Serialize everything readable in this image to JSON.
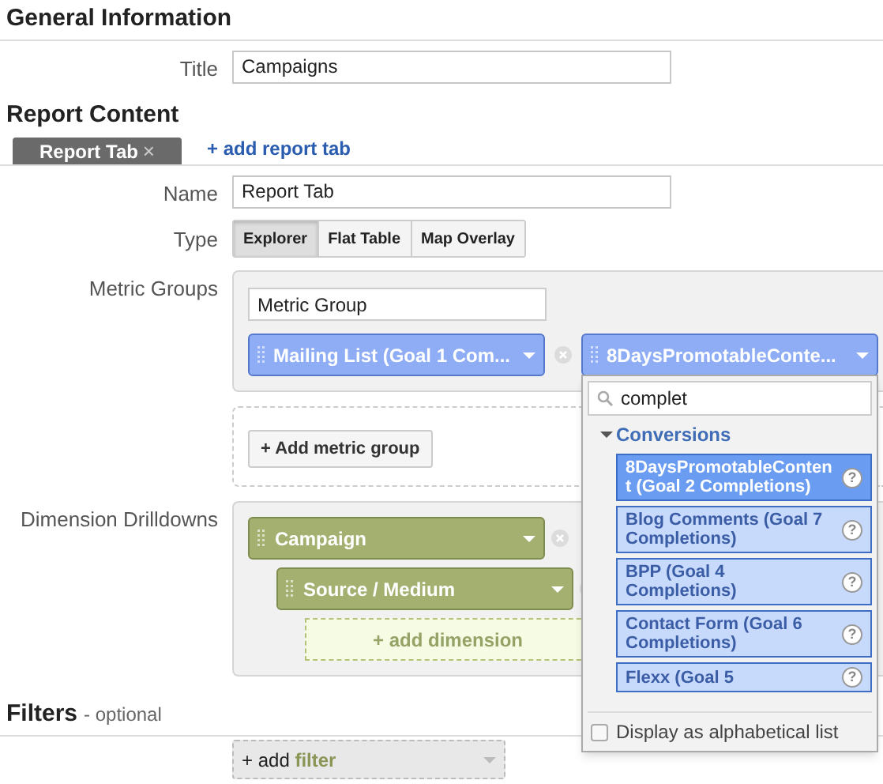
{
  "general": {
    "heading": "General Information",
    "title_label": "Title",
    "title_value": "Campaigns"
  },
  "report_content": {
    "heading": "Report Content",
    "tabs": [
      {
        "label": "Report Tab",
        "close": "×",
        "selected": true
      }
    ],
    "add_tab": "+ add report tab"
  },
  "name": {
    "label": "Name",
    "value": "Report Tab"
  },
  "type": {
    "label": "Type",
    "options": [
      {
        "label": "Explorer",
        "selected": true
      },
      {
        "label": "Flat Table",
        "selected": false
      },
      {
        "label": "Map Overlay",
        "selected": false
      }
    ]
  },
  "metric_groups": {
    "label": "Metric Groups",
    "group_name": "Metric Group",
    "metrics": [
      {
        "label": "Mailing List (Goal 1 Com..."
      },
      {
        "label": "8DaysPromotableConte..."
      }
    ],
    "add_button": "+ Add metric group"
  },
  "dropdown": {
    "search": "complet",
    "category": "Conversions",
    "items": [
      {
        "label": "8DaysPromotableContent (Goal 2 Completions)",
        "help": "?",
        "selected": true
      },
      {
        "label": "Blog Comments (Goal 7 Completions)",
        "help": "?",
        "selected": false
      },
      {
        "label": "BPP (Goal 4 Completions)",
        "help": "?",
        "selected": false
      },
      {
        "label": "Contact Form (Goal 6 Completions)",
        "help": "?",
        "selected": false
      },
      {
        "label": "Flexx (Goal 5",
        "help": "?",
        "selected": false
      }
    ],
    "alphabetical": {
      "label": "Display as alphabetical list",
      "checked": false
    }
  },
  "dimensions": {
    "label": "Dimension Drilldowns",
    "items": [
      {
        "label": "Campaign",
        "children": [
          {
            "label": "Source / Medium"
          }
        ]
      }
    ],
    "add": "+ add dimension"
  },
  "filters": {
    "heading": "Filters",
    "note": "- optional",
    "add_prefix": "+ add",
    "add_word": "filter"
  }
}
